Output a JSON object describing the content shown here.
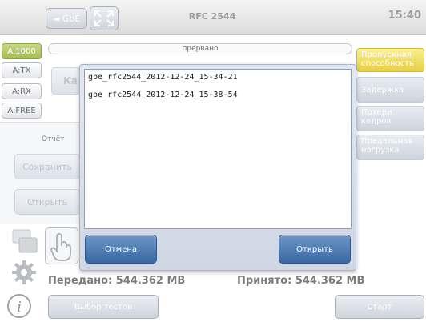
{
  "header": {
    "back_label": "◄ GbE",
    "title": "RFC 2544",
    "time": "15:40"
  },
  "ports": [
    {
      "label": "A:1000",
      "active": true
    },
    {
      "label": "A:TX",
      "active": false
    },
    {
      "label": "A:RX",
      "active": false
    },
    {
      "label": "A:FREE",
      "active": false
    }
  ],
  "main": {
    "status": "прервано",
    "tab_partial": "Ка",
    "report_label": "Отчёт",
    "save_label": "Сохранить",
    "open_label": "Открыть",
    "transmitted": "Передано: 544.362 MB",
    "received": "Принято: 544.362 MB"
  },
  "right_menu": [
    {
      "label": "Пропускная способность",
      "active": true
    },
    {
      "label": "Задержка",
      "active": false
    },
    {
      "label": "Потери кадров",
      "active": false
    },
    {
      "label": "Предельная нагрузка",
      "active": false
    }
  ],
  "dialog": {
    "files": [
      "gbe_rfc2544_2012-12-24_15-34-21",
      "gbe_rfc2544_2012-12-24_15-38-54"
    ],
    "cancel_label": "Отмена",
    "open_label": "Открыть"
  },
  "footer": {
    "select_tests_label": "Выбор тестов",
    "start_label": "Старт"
  },
  "colors": {
    "accent_blue": "#3a68a2",
    "active_port": "#a5bd52",
    "active_menu": "#e8cf45"
  }
}
